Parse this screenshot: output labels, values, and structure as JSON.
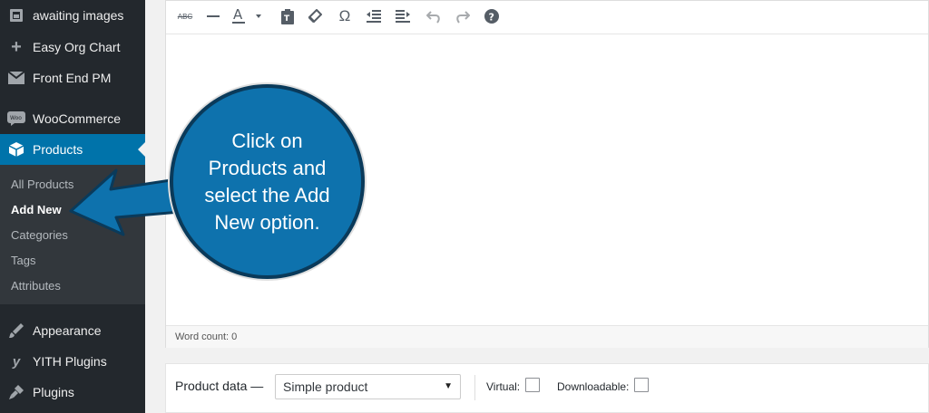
{
  "sidebar": {
    "items": [
      {
        "label": "awaiting images",
        "icon": "image-gallery-icon"
      },
      {
        "label": "Easy Org Chart",
        "icon": "plus-icon"
      },
      {
        "label": "Front End PM",
        "icon": "envelope-icon"
      },
      {
        "label": "WooCommerce",
        "icon": "woocommerce-icon"
      },
      {
        "label": "Products",
        "icon": "box-icon",
        "active": true
      },
      {
        "label": "Appearance",
        "icon": "paintbrush-icon"
      },
      {
        "label": "YITH Plugins",
        "icon": "yith-icon"
      },
      {
        "label": "Plugins",
        "icon": "plugin-icon"
      }
    ],
    "submenu": [
      "All Products",
      "Add New",
      "Categories",
      "Tags",
      "Attributes"
    ],
    "submenu_current": "Add New"
  },
  "editor": {
    "toolbar_icons": [
      "strikethrough-icon",
      "horizontal-line-icon",
      "text-color-icon",
      "paste-as-text-icon",
      "clear-formatting-icon",
      "special-character-icon",
      "outdent-icon",
      "indent-icon",
      "undo-icon",
      "redo-icon",
      "help-icon"
    ],
    "status": "Word count: 0"
  },
  "product_data": {
    "label": "Product data —",
    "type_selected": "Simple product",
    "virtual_label": "Virtual:",
    "downloadable_label": "Downloadable:"
  },
  "callout": {
    "text": "Click on Products and select the Add New option."
  },
  "colors": {
    "sidebar_bg": "#23282d",
    "submenu_bg": "#32373c",
    "active_blue": "#0073aa",
    "callout_blue": "#0e72ad",
    "callout_border": "#0a3a5a"
  }
}
